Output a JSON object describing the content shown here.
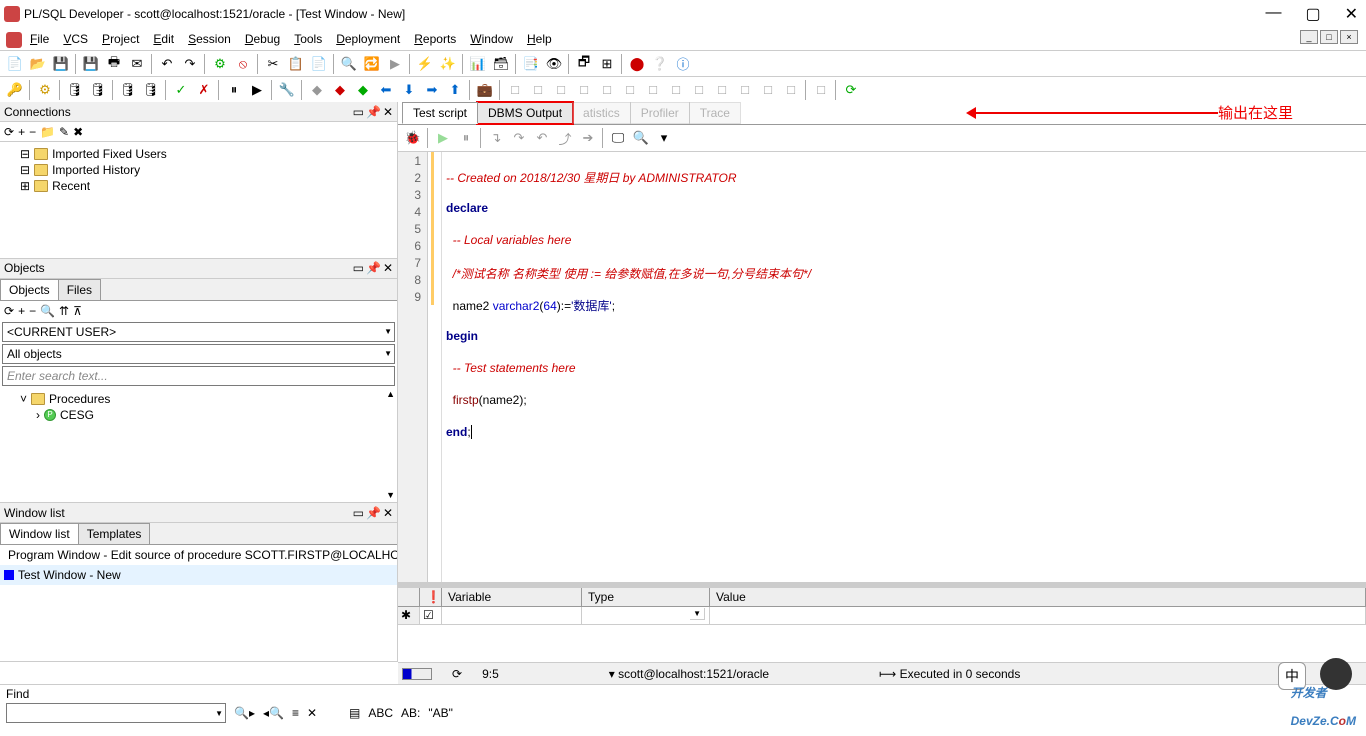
{
  "window": {
    "title": "PL/SQL Developer - scott@localhost:1521/oracle - [Test Window - New]"
  },
  "menu": {
    "file": "File",
    "vcs": "VCS",
    "project": "Project",
    "edit": "Edit",
    "session": "Session",
    "debug": "Debug",
    "tools": "Tools",
    "deployment": "Deployment",
    "reports": "Reports",
    "window": "Window",
    "help": "Help"
  },
  "panels": {
    "connections": {
      "title": "Connections"
    },
    "objects": {
      "title": "Objects",
      "tab_objects": "Objects",
      "tab_files": "Files",
      "current_user": "<CURRENT USER>",
      "all_objects": "All objects",
      "search_placeholder": "Enter search text..."
    },
    "windowlist": {
      "title": "Window list",
      "tab_wl": "Window list",
      "tab_tpl": "Templates"
    }
  },
  "conn_tree": {
    "n1": "Imported Fixed Users",
    "n2": "Imported History",
    "n3": "Recent"
  },
  "obj_tree": {
    "procedures": "Procedures",
    "cesg": "CESG"
  },
  "winlist": {
    "w1": "Program Window - Edit source of procedure SCOTT.FIRSTP@LOCALHO",
    "w2": "Test Window - New"
  },
  "editor_tabs": {
    "t1": "Test script",
    "t2": "DBMS Output",
    "t3": "atistics",
    "t4": "Profiler",
    "t5": "Trace"
  },
  "annotation": "输出在这里",
  "code": {
    "l1": "-- Created on 2018/12/30 星期日 by ADMINISTRATOR ",
    "l2_kw": "declare",
    "l3": "  -- Local variables here",
    "l4": "  /*测试名称 名称类型 使用 := 给参数赋值,在多说一句,分号结束本句*/",
    "l5_a": "  name2 ",
    "l5_b": "varchar2",
    "l5_c": "(",
    "l5_d": "64",
    "l5_e": "):=",
    "l5_f": "'数据库'",
    "l5_g": ";",
    "l6": "begin",
    "l7": "  -- Test statements here",
    "l8_a": "  firstp",
    "l8_b": "(name2);",
    "l9": "end",
    "l9_b": ";"
  },
  "vars": {
    "c1": "Variable",
    "c2": "Type",
    "c3": "Value"
  },
  "status": {
    "pos": "9:5",
    "conn": "scott@localhost:1521/oracle",
    "exec": "Executed in 0 seconds"
  },
  "find": {
    "label": "Find",
    "ab": "\"AB\"",
    "abc": "ABC",
    "abi": "AB:"
  },
  "watermark": {
    "p1": "开发者",
    "p2": "DevZe.C",
    "p3": "o",
    "p4": "M"
  }
}
